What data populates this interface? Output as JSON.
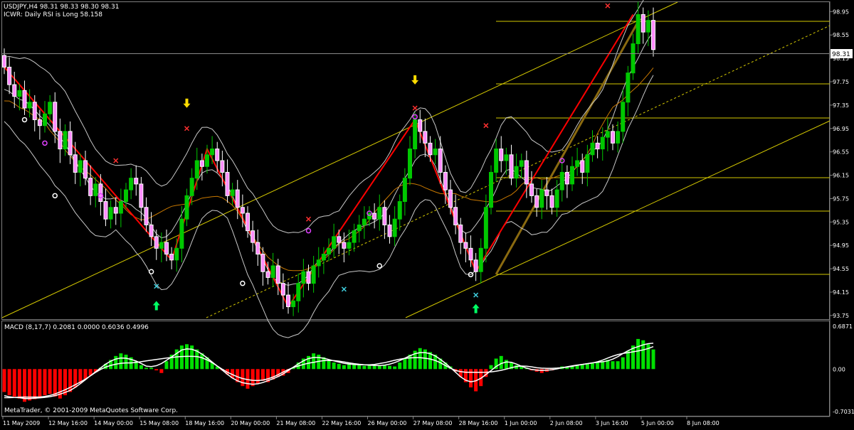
{
  "main_header": {
    "symbol_line": "USDJPY,H4  98.31 98.33 98.30 98.31",
    "indicator_line": "ICWR: Daily RSI is Long 58.158"
  },
  "macd_header": "MACD (8,17,7) 0.2081 0.0000 0.6036 0.4996",
  "footer_copyright": "MetaTrader, © 2001-2009 MetaQuotes Software Corp.",
  "price_scale": [
    "98.95",
    "98.55",
    "98.15",
    "97.75",
    "97.35",
    "96.95",
    "96.55",
    "96.15",
    "95.75",
    "95.35",
    "94.95",
    "94.55",
    "94.15",
    "93.75"
  ],
  "current_price": "98.31",
  "macd_scale": [
    "0.6871",
    "0.00",
    "-0.7031"
  ],
  "time_labels": [
    "11 May 2009",
    "12 May 16:00",
    "14 May 00:00",
    "15 May 08:00",
    "18 May 16:00",
    "20 May 00:00",
    "21 May 08:00",
    "22 May 16:00",
    "26 May 00:00",
    "27 May 08:00",
    "28 May 16:00",
    "1 Jun 00:00",
    "2 Jun 08:00",
    "3 Jun 16:00",
    "5 Jun 00:00",
    "8 Jun 08:00"
  ],
  "colors": {
    "background": "#000000",
    "bull_candle": "#00c800",
    "bear_candle": "#ffffff",
    "bear_body": "#ff8cff",
    "zigzag": "#ff0000",
    "channel": "#d4c800",
    "fibo": "#d4c800",
    "bollinger": "#c8c8c8",
    "moving_average": "#c87800",
    "macd_positive": "#00e000",
    "macd_negative": "#ff0000",
    "macd_line": "#ffffff"
  },
  "chart_data": {
    "type": "candlestick",
    "symbol": "USDJPY",
    "timeframe": "H4",
    "ylim": [
      93.7,
      99.1
    ],
    "closes": [
      98.0,
      97.7,
      97.5,
      97.6,
      97.3,
      97.4,
      97.1,
      97.0,
      97.2,
      97.4,
      96.9,
      96.6,
      96.9,
      96.5,
      96.2,
      96.4,
      96.1,
      95.8,
      96.0,
      95.7,
      95.4,
      95.6,
      95.5,
      95.7,
      95.9,
      96.1,
      96.0,
      95.6,
      95.3,
      95.1,
      94.9,
      95.0,
      94.8,
      94.7,
      94.9,
      95.4,
      95.8,
      96.1,
      96.4,
      96.3,
      96.5,
      96.6,
      96.4,
      96.2,
      95.8,
      95.9,
      95.6,
      95.5,
      95.2,
      95.0,
      94.8,
      94.5,
      94.4,
      94.6,
      94.3,
      94.1,
      93.9,
      94.0,
      94.3,
      94.5,
      94.3,
      94.6,
      94.7,
      94.8,
      94.9,
      95.1,
      95.0,
      94.9,
      95.0,
      95.2,
      95.3,
      95.4,
      95.5,
      95.4,
      95.6,
      95.3,
      95.1,
      95.4,
      95.7,
      96.1,
      96.6,
      97.1,
      96.9,
      96.7,
      96.5,
      96.6,
      96.2,
      95.9,
      95.6,
      95.3,
      95.0,
      94.9,
      94.7,
      94.5,
      94.9,
      95.6,
      96.2,
      96.6,
      96.4,
      96.5,
      96.1,
      96.3,
      96.4,
      96.0,
      95.8,
      95.6,
      95.9,
      95.8,
      95.6,
      95.9,
      96.2,
      96.0,
      96.3,
      96.4,
      96.2,
      96.5,
      96.7,
      96.6,
      96.8,
      96.9,
      96.7,
      96.9,
      97.4,
      97.9,
      98.4,
      98.9,
      98.6,
      98.8,
      98.3
    ]
  },
  "macd_data": {
    "histogram": [
      -0.35,
      -0.4,
      -0.42,
      -0.45,
      -0.5,
      -0.48,
      -0.46,
      -0.44,
      -0.4,
      -0.38,
      -0.42,
      -0.45,
      -0.4,
      -0.35,
      -0.28,
      -0.22,
      -0.16,
      -0.1,
      -0.05,
      0.02,
      0.08,
      0.14,
      0.2,
      0.24,
      0.22,
      0.18,
      0.12,
      0.06,
      0.02,
      0.02,
      -0.02,
      -0.06,
      0.12,
      0.22,
      0.3,
      0.36,
      0.38,
      0.36,
      0.3,
      0.24,
      0.18,
      0.1,
      0.04,
      -0.02,
      -0.08,
      -0.14,
      -0.2,
      -0.26,
      -0.3,
      -0.26,
      -0.22,
      -0.18,
      -0.2,
      -0.16,
      -0.12,
      -0.1,
      -0.06,
      0.02,
      0.1,
      0.16,
      0.2,
      0.24,
      0.22,
      0.18,
      0.14,
      0.1,
      0.08,
      0.06,
      0.1,
      0.08,
      0.06,
      0.05,
      0.06,
      0.05,
      0.06,
      0.06,
      0.05,
      0.04,
      0.1,
      0.16,
      0.22,
      0.28,
      0.32,
      0.3,
      0.26,
      0.22,
      0.16,
      0.1,
      0.04,
      -0.04,
      -0.12,
      -0.2,
      -0.28,
      -0.34,
      -0.26,
      -0.12,
      0.06,
      0.16,
      0.2,
      0.14,
      0.1,
      0.06,
      0.04,
      0.02,
      -0.02,
      -0.04,
      -0.06,
      -0.04,
      -0.02,
      0.02,
      0.04,
      0.03,
      0.05,
      0.06,
      0.07,
      0.08,
      0.1,
      0.1,
      0.12,
      0.14,
      0.12,
      0.12,
      0.18,
      0.28,
      0.36,
      0.46,
      0.44,
      0.38,
      0.3
    ],
    "ylim": [
      -0.7031,
      0.6871
    ]
  }
}
